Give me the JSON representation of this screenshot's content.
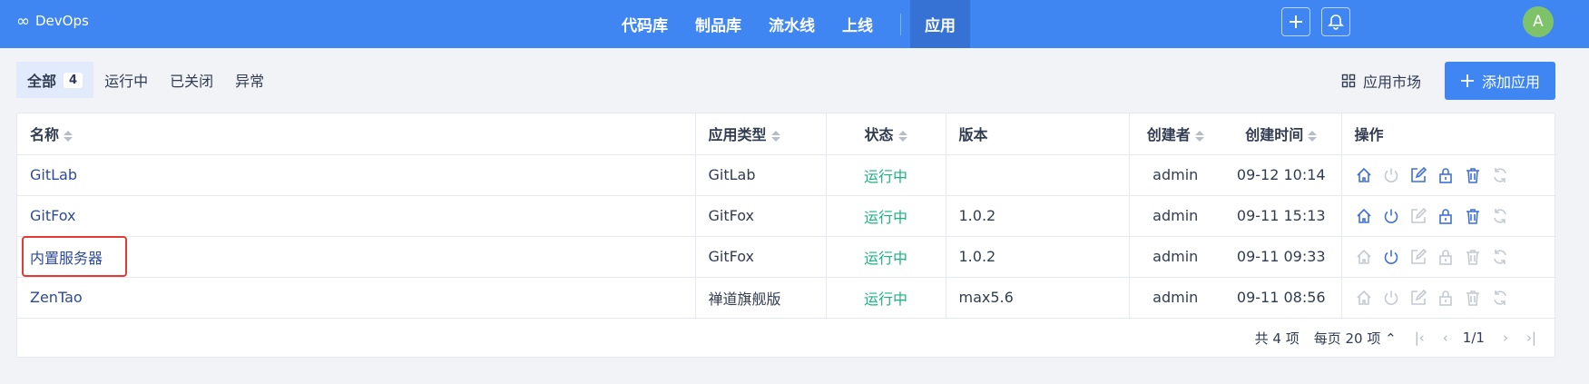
{
  "header": {
    "brand": "DevOps",
    "brand_icon": "infinity-icon",
    "nav": [
      "代码库",
      "制品库",
      "流水线",
      "上线"
    ],
    "nav_active": "应用",
    "avatar": "A",
    "accent": "#3f86f3"
  },
  "filters": {
    "all_label": "全部",
    "all_count": "4",
    "running": "运行中",
    "closed": "已关闭",
    "error": "异常"
  },
  "toolbar": {
    "market": "应用市场",
    "add": "添加应用"
  },
  "table": {
    "columns": {
      "name": "名称",
      "type": "应用类型",
      "status": "状态",
      "version": "版本",
      "creator": "创建者",
      "created": "创建时间",
      "ops": "操作"
    },
    "rows": [
      {
        "name": "GitLab",
        "type": "GitLab",
        "status": "运行中",
        "version": "",
        "creator": "admin",
        "created": "09-12 10:14",
        "enabled": [
          true,
          false,
          true,
          true,
          true,
          false
        ]
      },
      {
        "name": "GitFox",
        "type": "GitFox",
        "status": "运行中",
        "version": "1.0.2",
        "creator": "admin",
        "created": "09-11 15:13",
        "enabled": [
          true,
          true,
          false,
          true,
          true,
          false
        ]
      },
      {
        "name": "内置服务器",
        "type": "GitFox",
        "status": "运行中",
        "version": "1.0.2",
        "creator": "admin",
        "created": "09-11 09:33",
        "enabled": [
          false,
          true,
          false,
          false,
          false,
          false
        ]
      },
      {
        "name": "ZenTao",
        "type": "禅道旗舰版",
        "status": "运行中",
        "version": "max5.6",
        "creator": "admin",
        "created": "09-11 08:56",
        "enabled": [
          false,
          false,
          false,
          false,
          false,
          false
        ]
      }
    ],
    "action_icons": [
      "home-icon",
      "power-icon",
      "edit-icon",
      "lock-icon",
      "trash-icon",
      "refresh-icon"
    ]
  },
  "pager": {
    "total": "共 4 项",
    "per_page": "每页 20 项",
    "page": "1/1"
  }
}
